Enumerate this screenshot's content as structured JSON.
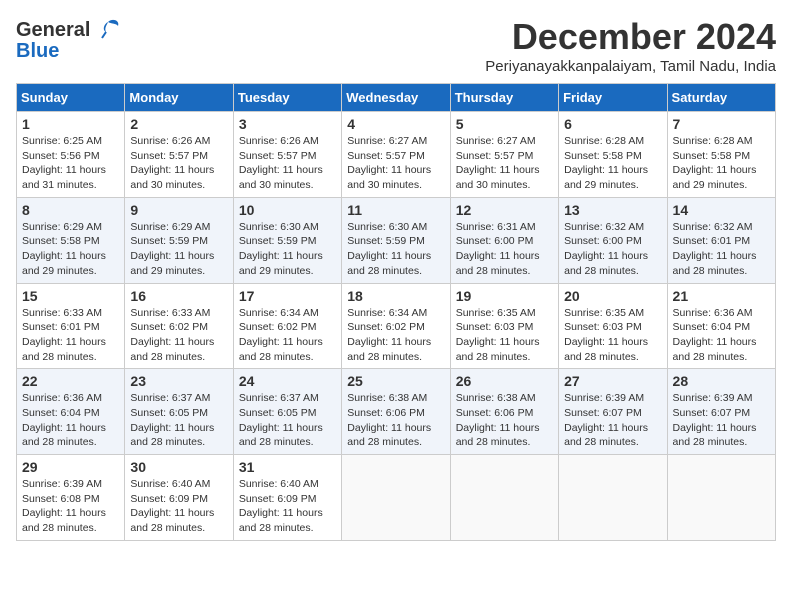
{
  "header": {
    "logo_line1": "General",
    "logo_line2": "Blue",
    "month_title": "December 2024",
    "location": "Periyanayakkanpalaiyam, Tamil Nadu, India"
  },
  "days_of_week": [
    "Sunday",
    "Monday",
    "Tuesday",
    "Wednesday",
    "Thursday",
    "Friday",
    "Saturday"
  ],
  "weeks": [
    [
      {
        "day": "1",
        "info": "Sunrise: 6:25 AM\nSunset: 5:56 PM\nDaylight: 11 hours\nand 31 minutes."
      },
      {
        "day": "2",
        "info": "Sunrise: 6:26 AM\nSunset: 5:57 PM\nDaylight: 11 hours\nand 30 minutes."
      },
      {
        "day": "3",
        "info": "Sunrise: 6:26 AM\nSunset: 5:57 PM\nDaylight: 11 hours\nand 30 minutes."
      },
      {
        "day": "4",
        "info": "Sunrise: 6:27 AM\nSunset: 5:57 PM\nDaylight: 11 hours\nand 30 minutes."
      },
      {
        "day": "5",
        "info": "Sunrise: 6:27 AM\nSunset: 5:57 PM\nDaylight: 11 hours\nand 30 minutes."
      },
      {
        "day": "6",
        "info": "Sunrise: 6:28 AM\nSunset: 5:58 PM\nDaylight: 11 hours\nand 29 minutes."
      },
      {
        "day": "7",
        "info": "Sunrise: 6:28 AM\nSunset: 5:58 PM\nDaylight: 11 hours\nand 29 minutes."
      }
    ],
    [
      {
        "day": "8",
        "info": "Sunrise: 6:29 AM\nSunset: 5:58 PM\nDaylight: 11 hours\nand 29 minutes."
      },
      {
        "day": "9",
        "info": "Sunrise: 6:29 AM\nSunset: 5:59 PM\nDaylight: 11 hours\nand 29 minutes."
      },
      {
        "day": "10",
        "info": "Sunrise: 6:30 AM\nSunset: 5:59 PM\nDaylight: 11 hours\nand 29 minutes."
      },
      {
        "day": "11",
        "info": "Sunrise: 6:30 AM\nSunset: 5:59 PM\nDaylight: 11 hours\nand 28 minutes."
      },
      {
        "day": "12",
        "info": "Sunrise: 6:31 AM\nSunset: 6:00 PM\nDaylight: 11 hours\nand 28 minutes."
      },
      {
        "day": "13",
        "info": "Sunrise: 6:32 AM\nSunset: 6:00 PM\nDaylight: 11 hours\nand 28 minutes."
      },
      {
        "day": "14",
        "info": "Sunrise: 6:32 AM\nSunset: 6:01 PM\nDaylight: 11 hours\nand 28 minutes."
      }
    ],
    [
      {
        "day": "15",
        "info": "Sunrise: 6:33 AM\nSunset: 6:01 PM\nDaylight: 11 hours\nand 28 minutes."
      },
      {
        "day": "16",
        "info": "Sunrise: 6:33 AM\nSunset: 6:02 PM\nDaylight: 11 hours\nand 28 minutes."
      },
      {
        "day": "17",
        "info": "Sunrise: 6:34 AM\nSunset: 6:02 PM\nDaylight: 11 hours\nand 28 minutes."
      },
      {
        "day": "18",
        "info": "Sunrise: 6:34 AM\nSunset: 6:02 PM\nDaylight: 11 hours\nand 28 minutes."
      },
      {
        "day": "19",
        "info": "Sunrise: 6:35 AM\nSunset: 6:03 PM\nDaylight: 11 hours\nand 28 minutes."
      },
      {
        "day": "20",
        "info": "Sunrise: 6:35 AM\nSunset: 6:03 PM\nDaylight: 11 hours\nand 28 minutes."
      },
      {
        "day": "21",
        "info": "Sunrise: 6:36 AM\nSunset: 6:04 PM\nDaylight: 11 hours\nand 28 minutes."
      }
    ],
    [
      {
        "day": "22",
        "info": "Sunrise: 6:36 AM\nSunset: 6:04 PM\nDaylight: 11 hours\nand 28 minutes."
      },
      {
        "day": "23",
        "info": "Sunrise: 6:37 AM\nSunset: 6:05 PM\nDaylight: 11 hours\nand 28 minutes."
      },
      {
        "day": "24",
        "info": "Sunrise: 6:37 AM\nSunset: 6:05 PM\nDaylight: 11 hours\nand 28 minutes."
      },
      {
        "day": "25",
        "info": "Sunrise: 6:38 AM\nSunset: 6:06 PM\nDaylight: 11 hours\nand 28 minutes."
      },
      {
        "day": "26",
        "info": "Sunrise: 6:38 AM\nSunset: 6:06 PM\nDaylight: 11 hours\nand 28 minutes."
      },
      {
        "day": "27",
        "info": "Sunrise: 6:39 AM\nSunset: 6:07 PM\nDaylight: 11 hours\nand 28 minutes."
      },
      {
        "day": "28",
        "info": "Sunrise: 6:39 AM\nSunset: 6:07 PM\nDaylight: 11 hours\nand 28 minutes."
      }
    ],
    [
      {
        "day": "29",
        "info": "Sunrise: 6:39 AM\nSunset: 6:08 PM\nDaylight: 11 hours\nand 28 minutes."
      },
      {
        "day": "30",
        "info": "Sunrise: 6:40 AM\nSunset: 6:09 PM\nDaylight: 11 hours\nand 28 minutes."
      },
      {
        "day": "31",
        "info": "Sunrise: 6:40 AM\nSunset: 6:09 PM\nDaylight: 11 hours\nand 28 minutes."
      },
      {
        "day": "",
        "info": ""
      },
      {
        "day": "",
        "info": ""
      },
      {
        "day": "",
        "info": ""
      },
      {
        "day": "",
        "info": ""
      }
    ]
  ]
}
